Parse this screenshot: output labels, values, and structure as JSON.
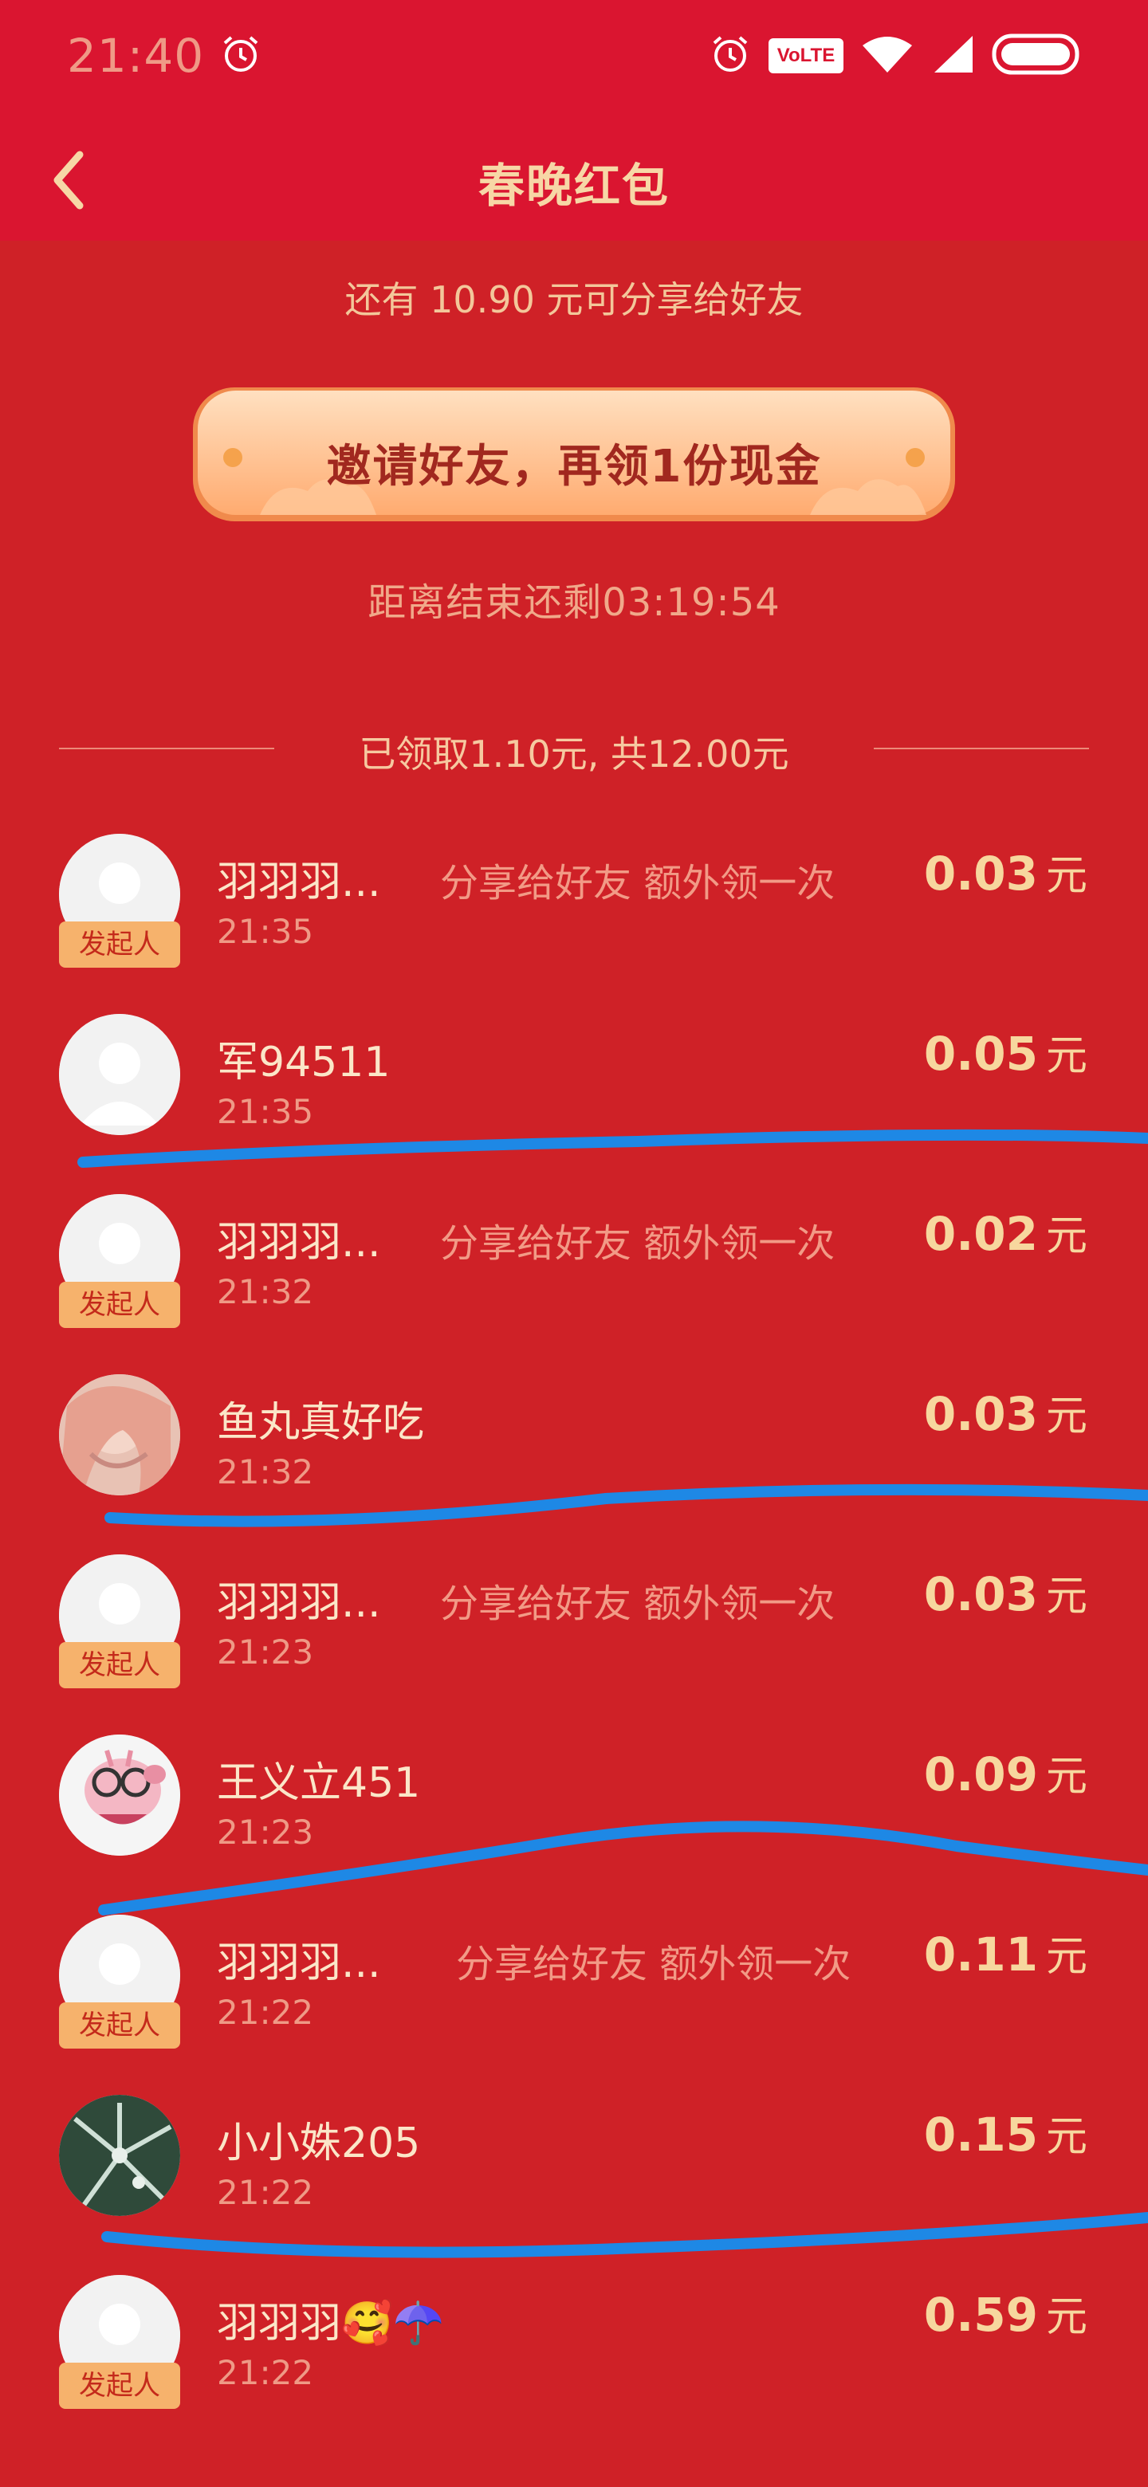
{
  "status_bar": {
    "time": "21:40",
    "volte": "VoLTE"
  },
  "header": {
    "title": "春晚红包"
  },
  "share_remaining": "还有 10.90 元可分享给好友",
  "invite_button": "邀请好友，再领1份现金",
  "countdown": "距离结束还剩03:19:54",
  "summary": "已领取1.10元, 共12.00元",
  "records": [
    {
      "name": "羽羽羽...",
      "extra": "分享给好友 额外领一次",
      "time": "21:35",
      "amount": "0.03",
      "unit": "元",
      "badge": "发起人"
    },
    {
      "name": "军94511",
      "extra": "",
      "time": "21:35",
      "amount": "0.05",
      "unit": "元",
      "badge": ""
    },
    {
      "name": "羽羽羽...",
      "extra": "分享给好友 额外领一次",
      "time": "21:32",
      "amount": "0.02",
      "unit": "元",
      "badge": "发起人"
    },
    {
      "name": "鱼丸真好吃",
      "extra": "",
      "time": "21:32",
      "amount": "0.03",
      "unit": "元",
      "badge": ""
    },
    {
      "name": "羽羽羽...",
      "extra": "分享给好友 额外领一次",
      "time": "21:23",
      "amount": "0.03",
      "unit": "元",
      "badge": "发起人"
    },
    {
      "name": "王义立451",
      "extra": "",
      "time": "21:23",
      "amount": "0.09",
      "unit": "元",
      "badge": ""
    },
    {
      "name": "羽羽羽...",
      "extra": "分享给好友 额外领一次",
      "time": "21:22",
      "amount": "0.11",
      "unit": "元",
      "badge": "发起人"
    },
    {
      "name": "小小姝205",
      "extra": "",
      "time": "21:22",
      "amount": "0.15",
      "unit": "元",
      "badge": ""
    },
    {
      "name": "羽羽羽🥰☂️",
      "extra": "",
      "time": "21:22",
      "amount": "0.59",
      "unit": "元",
      "badge": "发起人"
    }
  ],
  "colors": {
    "background": "#cf2127",
    "header": "#da1530",
    "annotation": "#1e88e5"
  }
}
